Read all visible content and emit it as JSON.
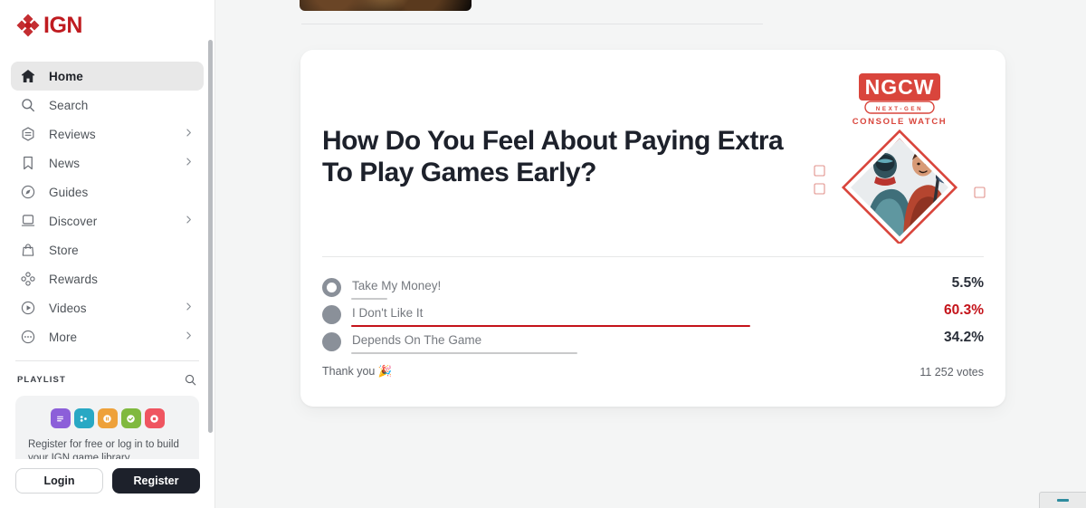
{
  "brand": {
    "name": "IGN",
    "logo_color": "#bf1b20"
  },
  "sidebar": {
    "nav": [
      {
        "label": "Home",
        "icon": "home-icon",
        "active": true,
        "caret": false
      },
      {
        "label": "Search",
        "icon": "search-icon",
        "active": false,
        "caret": false
      },
      {
        "label": "Reviews",
        "icon": "reviews-icon",
        "active": false,
        "caret": true
      },
      {
        "label": "News",
        "icon": "news-icon",
        "active": false,
        "caret": true
      },
      {
        "label": "Guides",
        "icon": "guides-icon",
        "active": false,
        "caret": false
      },
      {
        "label": "Discover",
        "icon": "discover-icon",
        "active": false,
        "caret": true
      },
      {
        "label": "Store",
        "icon": "store-icon",
        "active": false,
        "caret": false
      },
      {
        "label": "Rewards",
        "icon": "rewards-icon",
        "active": false,
        "caret": false
      },
      {
        "label": "Videos",
        "icon": "videos-icon",
        "active": false,
        "caret": true
      },
      {
        "label": "More",
        "icon": "more-icon",
        "active": false,
        "caret": true
      }
    ],
    "playlist": {
      "title": "PLAYLIST",
      "search_icon": "search-icon",
      "promo_text": "Register for free or log in to build your IGN game library.",
      "icons": [
        {
          "name": "playlist-list-icon",
          "color": "#8c5fd9"
        },
        {
          "name": "playlist-playing-icon",
          "color": "#29a8c4"
        },
        {
          "name": "playlist-paused-icon",
          "color": "#eea13a"
        },
        {
          "name": "playlist-done-icon",
          "color": "#80b93f"
        },
        {
          "name": "playlist-dropped-icon",
          "color": "#ef5560"
        }
      ]
    },
    "auth": {
      "login_label": "Login",
      "register_label": "Register"
    }
  },
  "poll": {
    "title": "How Do You Feel About Paying Extra To Play Games Early?",
    "artwork": {
      "name": "NGCW",
      "subtitle": "N E X T · G E N",
      "tagline": "CONSOLE WATCH",
      "accent_color": "#d9453c"
    },
    "thanks_text": "Thank you 🎉",
    "votes_text": "11 252 votes",
    "winner_color": "#c4131a",
    "chart_data": {
      "type": "bar",
      "title": "How Do You Feel About Paying Extra To Play Games Early?",
      "categories": [
        "Take My Money!",
        "I Don't Like It",
        "Depends On The Game"
      ],
      "values": [
        5.5,
        60.3,
        34.2
      ],
      "value_labels": [
        "5.5%",
        "60.3%",
        "34.2%"
      ],
      "bar_colors": [
        "#c9cacb",
        "#c4131a",
        "#c9cacb"
      ],
      "selected_index": 0,
      "winner_index": 1,
      "total_votes": "11 252 votes",
      "xlabel": "",
      "ylabel": "",
      "ylim": [
        0,
        100
      ],
      "orientation": "horizontal",
      "grid": false,
      "legend": false
    }
  }
}
